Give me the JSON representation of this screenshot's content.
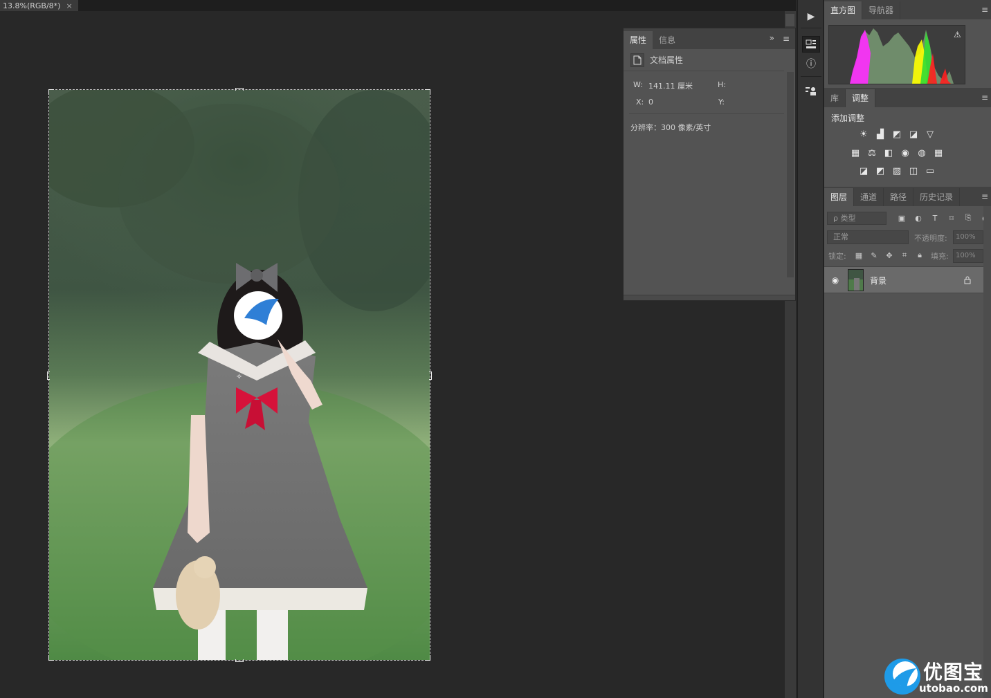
{
  "document": {
    "tab_title": "13.8%(RGB/8*)",
    "tab_close": "×"
  },
  "properties_panel": {
    "tabs": [
      {
        "label": "属性",
        "active": true
      },
      {
        "label": "信息",
        "active": false
      }
    ],
    "collapse_glyph": "»",
    "menu_glyph": "≡",
    "header": "文档属性",
    "w_label": "W:",
    "w_value": "141.11 厘米",
    "h_label": "H:",
    "h_value": "",
    "x_label": "X:",
    "x_value": "0",
    "y_label": "Y:",
    "y_value": "",
    "resolution": "分辨率：300 像素/英寸"
  },
  "histogram_panel": {
    "tabs": [
      {
        "label": "直方图",
        "active": true
      },
      {
        "label": "导航器",
        "active": false
      }
    ],
    "menu_glyph": "≡",
    "warning_glyph": "⚠"
  },
  "adjustments_panel": {
    "tabs": [
      {
        "label": "库",
        "active": false
      },
      {
        "label": "调整",
        "active": true
      }
    ],
    "menu_glyph": "≡",
    "title": "添加调整",
    "rows": [
      [
        "brightness-contrast-icon",
        "levels-icon",
        "curves-icon",
        "exposure-icon",
        "vibrance-icon"
      ],
      [
        "hue-saturation-icon",
        "color-balance-icon",
        "black-white-icon",
        "photo-filter-icon",
        "channel-mixer-icon",
        "color-lookup-icon"
      ],
      [
        "invert-icon",
        "posterize-icon",
        "threshold-icon",
        "selective-color-icon",
        "gradient-map-icon"
      ]
    ],
    "glyphs": [
      [
        "☀",
        "▟",
        "◩",
        "◪",
        "▽"
      ],
      [
        "▦",
        "⚖",
        "◧",
        "◉",
        "◍",
        "▦"
      ],
      [
        "◪",
        "◩",
        "▨",
        "◫",
        "▭"
      ]
    ]
  },
  "layers_panel": {
    "tabs": [
      {
        "label": "图层",
        "active": true
      },
      {
        "label": "通道",
        "active": false
      },
      {
        "label": "路径",
        "active": false
      },
      {
        "label": "历史记录",
        "active": false
      }
    ],
    "menu_glyph": "≡",
    "filter_placeholder": "ρ 类型",
    "blend_mode": "正常",
    "opacity_label": "不透明度:",
    "opacity_value": "100%",
    "lock_label": "锁定:",
    "fill_label": "填充:",
    "fill_value": "100%",
    "layers": [
      {
        "name": "背景",
        "visible": true,
        "locked": true
      }
    ]
  },
  "tool_strip": {
    "play_glyph": "▶",
    "info_glyph": "ⓘ"
  },
  "watermark": {
    "title": "优图宝",
    "url": "utobao.com"
  },
  "colors": {
    "app_bg": "#282828",
    "panel_bg": "#535353",
    "tab_bar": "#424242",
    "layer_selected": "#6a6a6a",
    "watermark_blue": "#1e9be8"
  }
}
